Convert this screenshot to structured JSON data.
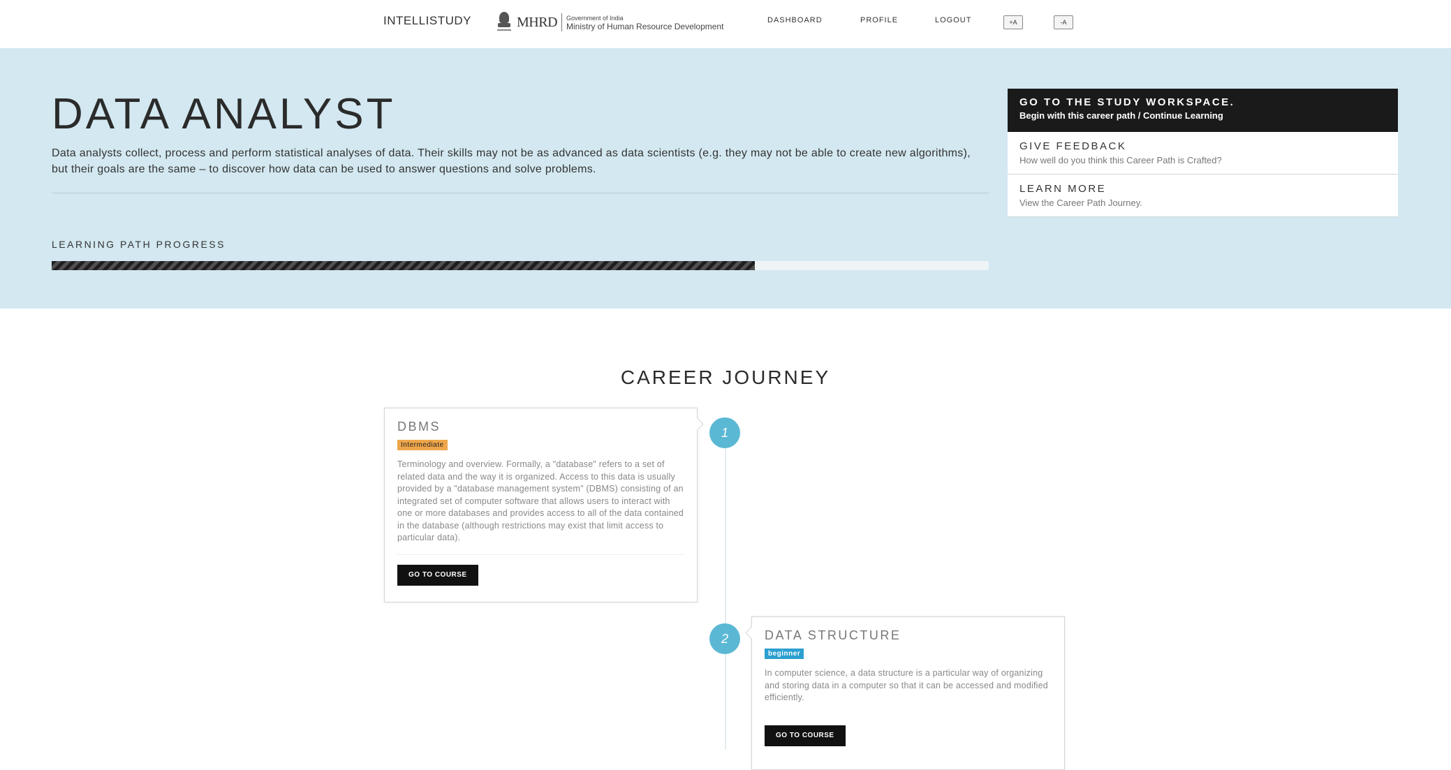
{
  "nav": {
    "brand": "INTELLISTUDY",
    "logo": {
      "mhrd": "MHRD",
      "gov": "Government of India",
      "ministry": "Ministry of Human Resource Development"
    },
    "links": [
      "DASHBOARD",
      "PROFILE",
      "LOGOUT"
    ],
    "font_increase": "+A",
    "font_decrease": "-A"
  },
  "hero": {
    "title": "DATA ANALYST",
    "description": "Data analysts collect, process and perform statistical analyses of data. Their skills may not be as advanced as data scientists (e.g. they may not be able to create new algorithms), but their goals are the same – to discover how data can be used to answer questions and solve problems.",
    "progress_label": "LEARNING PATH PROGRESS",
    "progress_percent": 75,
    "background_color": "#d3e8f0"
  },
  "side_menu": [
    {
      "title": "GO TO THE STUDY WORKSPACE.",
      "subtitle": "Begin with this career path / Continue Learning"
    },
    {
      "title": "GIVE FEEDBACK",
      "subtitle": "How well do you think this Career Path is Crafted?"
    },
    {
      "title": "LEARN MORE",
      "subtitle": "View the Career Path Journey."
    }
  ],
  "journey": {
    "title": "CAREER JOURNEY",
    "accent_color": "#5bb8d4",
    "steps": [
      {
        "number": "1",
        "title": "DBMS",
        "level": "Intermediate",
        "level_color": "#efa64a",
        "description": "Terminology and overview. Formally, a \"database\" refers to a set of related data and the way it is organized. Access to this data is usually provided by a \"database management system\" (DBMS) consisting of an integrated set of computer software that allows users to interact with one or more databases and provides access to all of the data contained in the database (although restrictions may exist that limit access to particular data).",
        "button": "GO TO COURSE"
      },
      {
        "number": "2",
        "title": "DATA STRUCTURE",
        "level": "beginner",
        "level_color": "#2b9fd0",
        "description": "In computer science, a data structure is a particular way of organizing and storing data in a computer so that it can be accessed and modified efficiently.",
        "button": "GO TO COURSE"
      }
    ]
  }
}
